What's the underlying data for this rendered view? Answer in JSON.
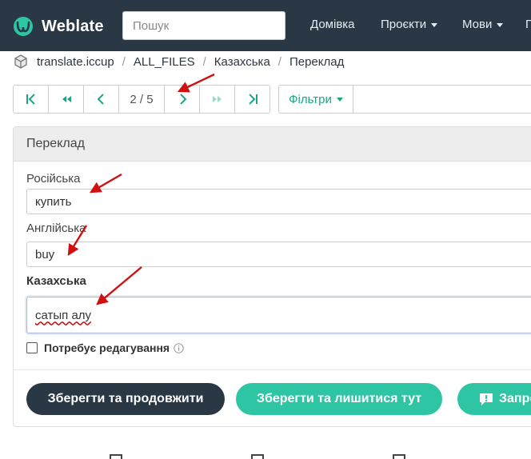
{
  "navbar": {
    "brand": "Weblate",
    "search_placeholder": "Пошук",
    "items": [
      {
        "label": "Домівка"
      },
      {
        "label": "Проєкти"
      },
      {
        "label": "Мови"
      },
      {
        "label": "П"
      }
    ]
  },
  "breadcrumb": {
    "items": [
      "translate.iccup",
      "ALL_FILES",
      "Казахська",
      "Переклад"
    ],
    "separator": "/"
  },
  "pager": {
    "position": "2 / 5",
    "filter_label": "Фільтри"
  },
  "panel": {
    "title": "Переклад",
    "source_label": "Російська",
    "source_value": "купить",
    "english_label": "Англійська",
    "english_value": "buy",
    "target_label": "Казахська",
    "target_value": "сатып алу",
    "needs_editing_label": "Потребує редагування",
    "needs_editing_checked": false
  },
  "buttons": {
    "save_continue": "Зберегти та продовжити",
    "save_stay": "Зберегти та лишитися тут",
    "suggest": "Запро"
  },
  "colors": {
    "navbar": "#2a3744",
    "accent": "#2ec5a5",
    "pager_icon": "#1fa385",
    "annotation_arrow": "#d01010"
  }
}
